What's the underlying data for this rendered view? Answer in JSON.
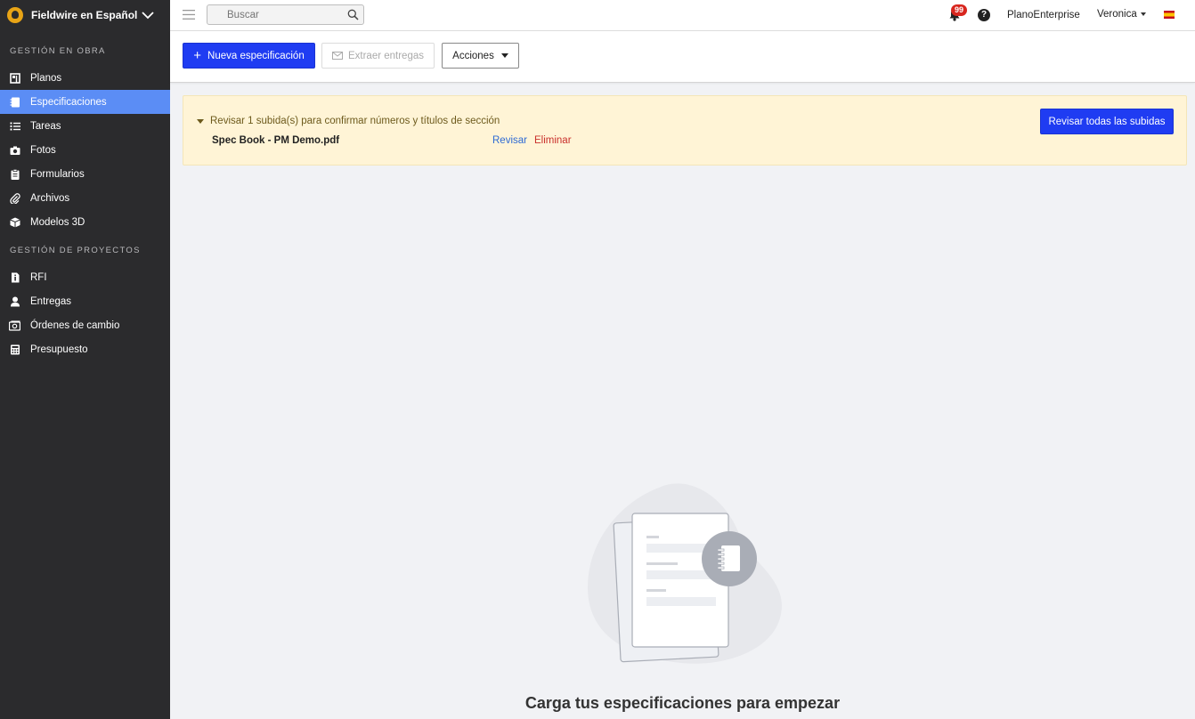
{
  "brand": {
    "name": "Fieldwire en Español"
  },
  "sidebar": {
    "sections": [
      {
        "title": "GESTIÓN EN OBRA",
        "items": [
          {
            "label": "Planos",
            "icon": "plans-icon"
          },
          {
            "label": "Especificaciones",
            "icon": "specifications-icon",
            "active": true
          },
          {
            "label": "Tareas",
            "icon": "tasks-icon"
          },
          {
            "label": "Fotos",
            "icon": "camera-icon"
          },
          {
            "label": "Formularios",
            "icon": "clipboard-icon"
          },
          {
            "label": "Archivos",
            "icon": "paperclip-icon"
          },
          {
            "label": "Modelos 3D",
            "icon": "cube-icon"
          }
        ]
      },
      {
        "title": "GESTIÓN DE PROYECTOS",
        "items": [
          {
            "label": "RFI",
            "icon": "rfi-icon"
          },
          {
            "label": "Entregas",
            "icon": "person-icon"
          },
          {
            "label": "Órdenes de cambio",
            "icon": "change-order-icon"
          },
          {
            "label": "Presupuesto",
            "icon": "calculator-icon"
          }
        ]
      }
    ]
  },
  "topbar": {
    "search_placeholder": "Buscar",
    "notifications_count": "99",
    "help_label": "?",
    "organization": "PlanoEnterprise",
    "user_name": "Veronica",
    "language_flag": "spain-flag-icon"
  },
  "toolbar": {
    "new_spec_label": "Nueva especificación",
    "extract_label": "Extraer entregas",
    "actions_label": "Acciones"
  },
  "banner": {
    "message": "Revisar 1 subida(s) para confirmar números y títulos de sección",
    "file_name": "Spec Book - PM Demo.pdf",
    "review_label": "Revisar",
    "delete_label": "Eliminar",
    "review_all_label": "Revisar todas las subidas"
  },
  "empty_state": {
    "title": "Carga tus especificaciones para empezar"
  },
  "colors": {
    "sidebar_bg": "#2b2b2d",
    "sidebar_active": "#5b8df5",
    "primary": "#1f3cf2",
    "banner_bg": "#fff4d6",
    "badge": "#d8261e"
  }
}
